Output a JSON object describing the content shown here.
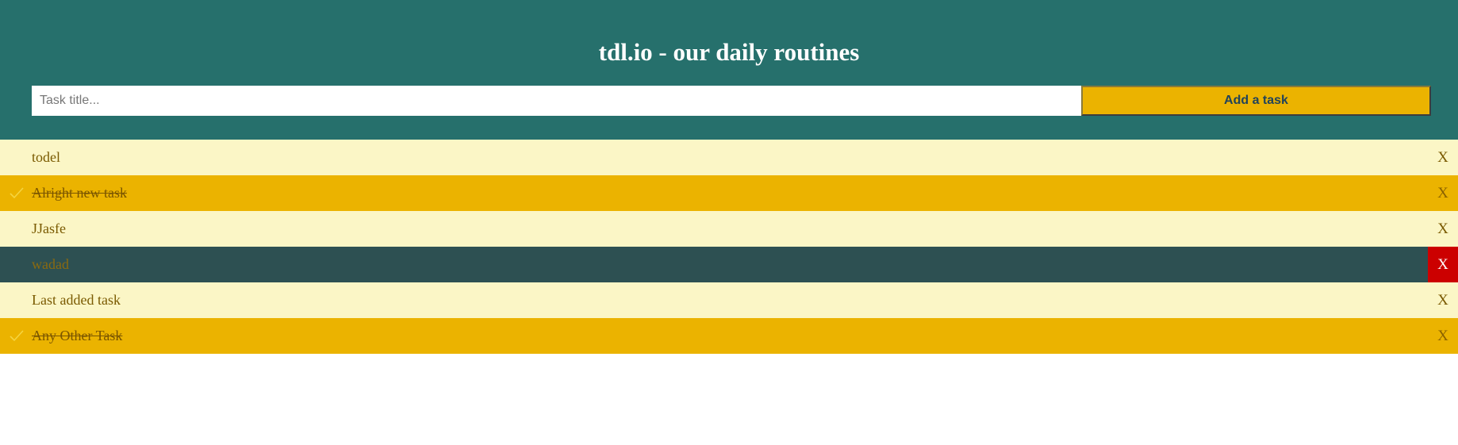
{
  "header": {
    "title": "tdl.io - our daily routines",
    "input_placeholder": "Task title...",
    "input_value": "",
    "add_button_label": "Add a task"
  },
  "tasks": [
    {
      "label": "todel",
      "done": false,
      "delete_label": "X"
    },
    {
      "label": "Alright new task",
      "done": true,
      "delete_label": "X",
      "check_icon": "check-icon"
    },
    {
      "label": "JJasfe",
      "done": false,
      "delete_label": "X"
    },
    {
      "label": "wadad",
      "done": false,
      "delete_label": "X",
      "state": "hovered"
    },
    {
      "label": "Last added task",
      "done": false,
      "delete_label": "X"
    },
    {
      "label": "Any Other Task",
      "done": true,
      "delete_label": "X",
      "check_icon": "check-icon"
    }
  ],
  "colors": {
    "header_bg": "#26706c",
    "todo_bg": "#fbf6c6",
    "done_bg": "#ebb300",
    "hover_bg": "#2d5052",
    "delete_hover_bg": "#cc0000",
    "button_bg": "#ebb300"
  }
}
